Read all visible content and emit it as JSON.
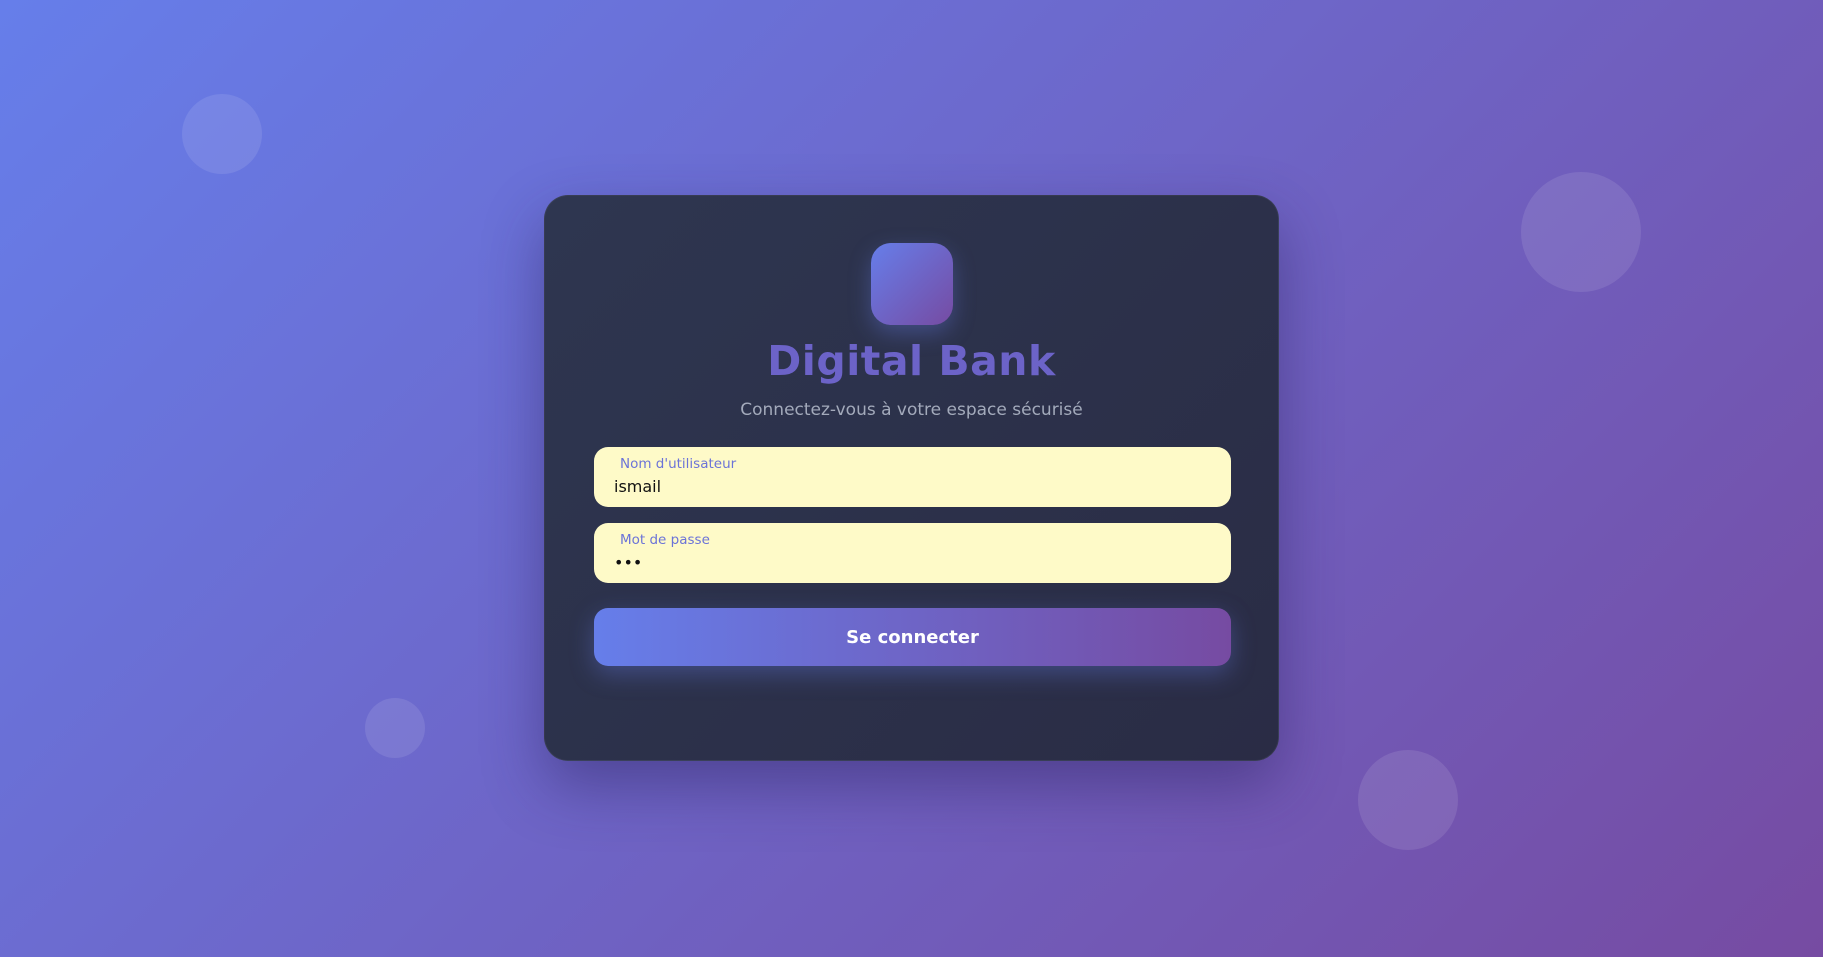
{
  "app": {
    "title": "Digital Bank",
    "subtitle": "Connectez-vous à votre espace sécurisé"
  },
  "form": {
    "username": {
      "label": "Nom d'utilisateur",
      "value": "ismail"
    },
    "password": {
      "label": "Mot de passe",
      "value": "•••"
    },
    "submit_label": "Se connecter"
  },
  "colors": {
    "gradient_start": "#667eea",
    "gradient_end": "#764ba2",
    "card_background": "#2e3650",
    "title": "#6c63c8",
    "field_background": "#fefac8",
    "field_label": "#6b73d8"
  }
}
